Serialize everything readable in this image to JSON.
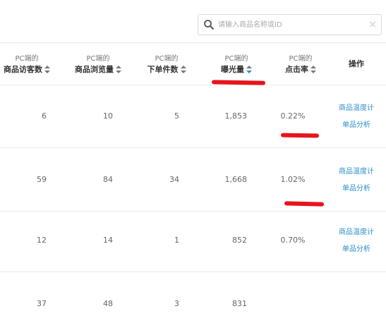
{
  "search": {
    "placeholder": "请输入商品名称或ID",
    "value": "",
    "clear_label": "×"
  },
  "columns": [
    {
      "small": "PC端的",
      "big": "商品访客数"
    },
    {
      "small": "PC端的",
      "big": "商品浏览量"
    },
    {
      "small": "PC端的",
      "big": "下单件数"
    },
    {
      "small": "PC端的",
      "big": "曝光量",
      "sorted": "desc"
    },
    {
      "small": "PC端的",
      "big": "点击率"
    }
  ],
  "operations_header": "操作",
  "rows": [
    {
      "visitors": "6",
      "views": "10",
      "orders": "5",
      "exposure": "1,853",
      "ctr": "0.22%",
      "actions": [
        "商品温度计",
        "单品分析"
      ]
    },
    {
      "visitors": "59",
      "views": "84",
      "orders": "34",
      "exposure": "1,668",
      "ctr": "1.02%",
      "actions": [
        "商品温度计",
        "单品分析"
      ]
    },
    {
      "visitors": "12",
      "views": "14",
      "orders": "1",
      "exposure": "852",
      "ctr": "0.70%",
      "actions": [
        "商品温度计",
        "单品分析"
      ]
    },
    {
      "visitors": "37",
      "views": "48",
      "orders": "3",
      "exposure": "831",
      "ctr": "",
      "actions": []
    }
  ],
  "colors": {
    "link": "#2a8fcc",
    "annotation": "#e8141b",
    "border": "#e8e8e8"
  }
}
